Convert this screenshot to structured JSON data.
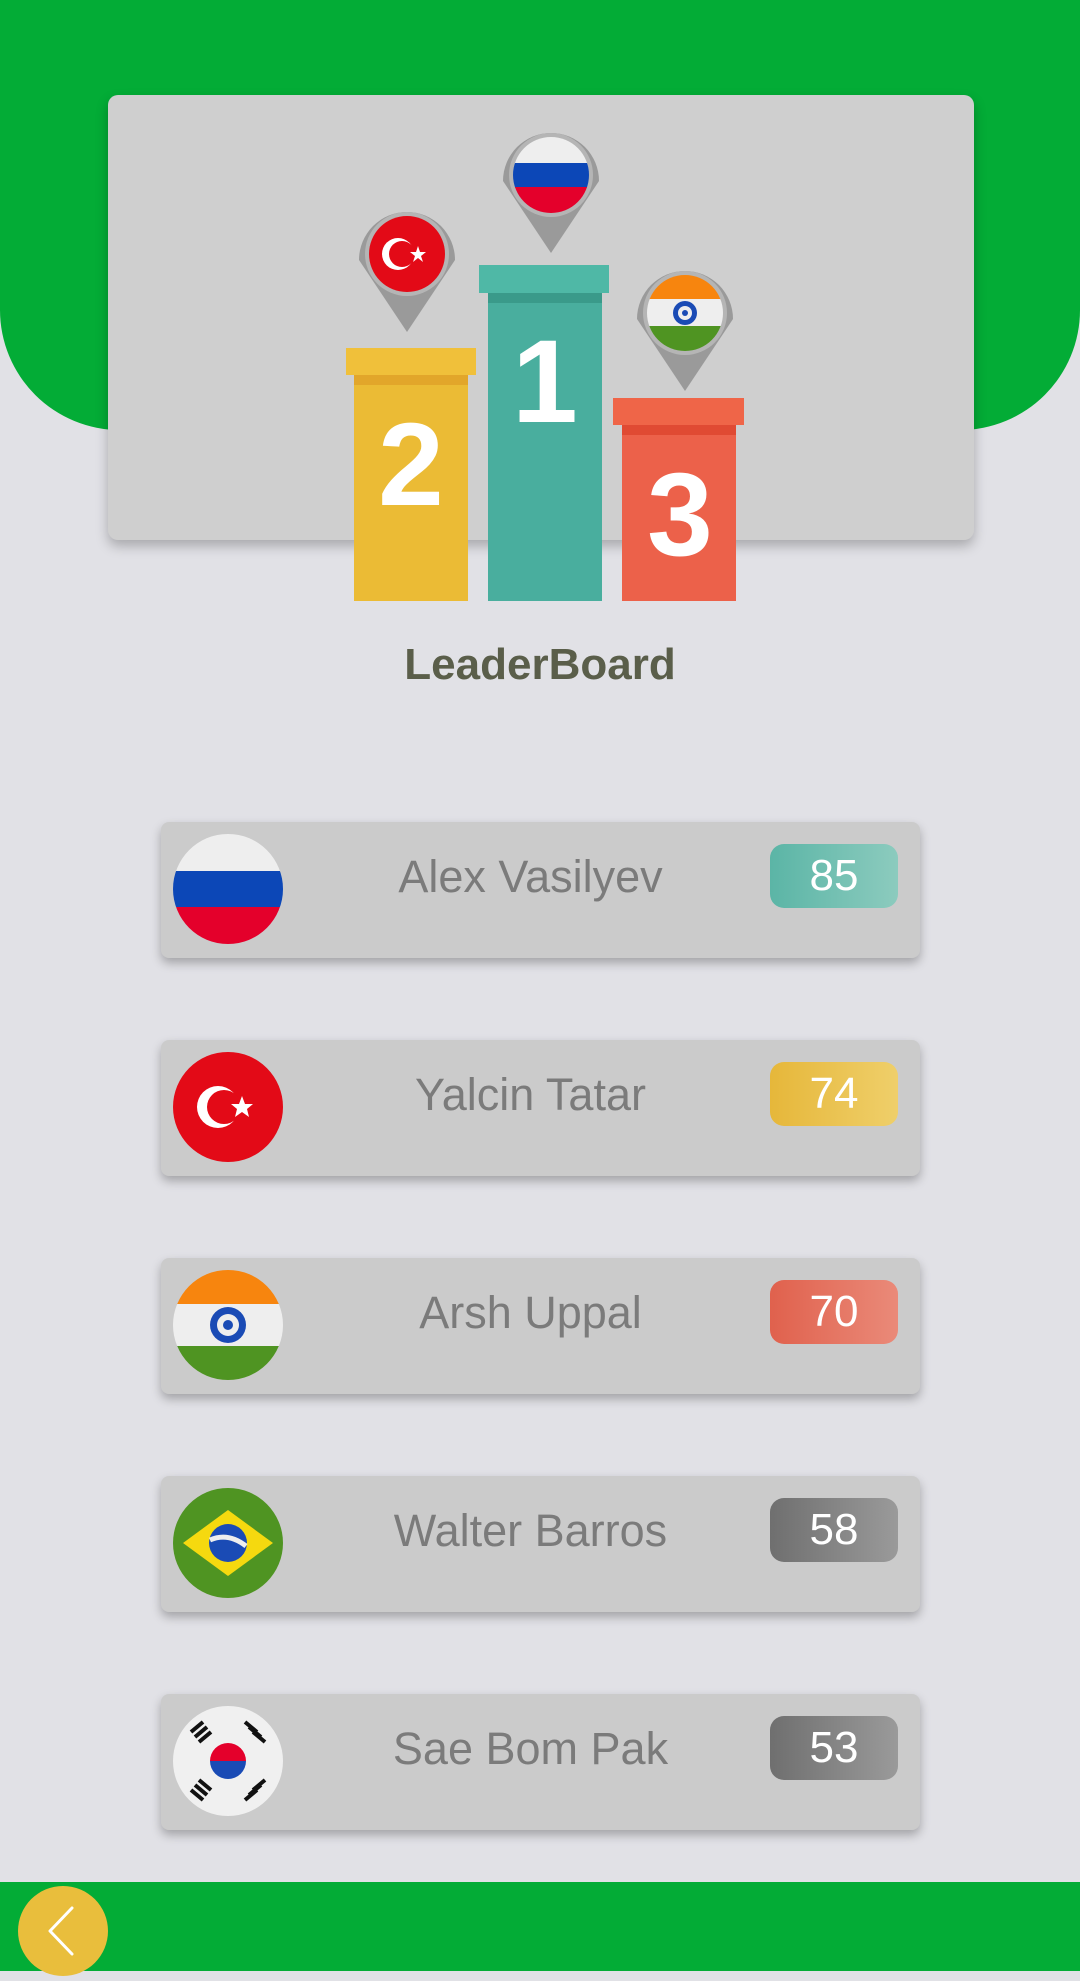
{
  "header": {
    "title": "LeaderBoard"
  },
  "podium": {
    "places": [
      {
        "rank": "2",
        "flag": "turkey-flag",
        "color": "#ebbb35"
      },
      {
        "rank": "1",
        "flag": "russia-flag",
        "color": "#49ae9e"
      },
      {
        "rank": "3",
        "flag": "india-flag",
        "color": "#ec614a"
      }
    ]
  },
  "players": [
    {
      "name": "Alex Vasilyev",
      "score": "85",
      "flag": "russia-flag",
      "badge_color": "#5bbca9"
    },
    {
      "name": "Yalcin Tatar",
      "score": "74",
      "flag": "turkey-flag",
      "badge_color": "#e8bd44"
    },
    {
      "name": "Arsh Uppal",
      "score": "70",
      "flag": "india-flag",
      "badge_color": "#e46b57"
    },
    {
      "name": "Walter Barros",
      "score": "58",
      "flag": "brazil-flag",
      "badge_color": "#7a7a7a"
    },
    {
      "name": "Sae Bom Pak",
      "score": "53",
      "flag": "south-korea-flag",
      "badge_color": "#7a7a7a"
    }
  ],
  "footer": {
    "back_icon": "chevron-left-icon",
    "accent": "#e9be3c",
    "bar_color": "#03ac36"
  }
}
